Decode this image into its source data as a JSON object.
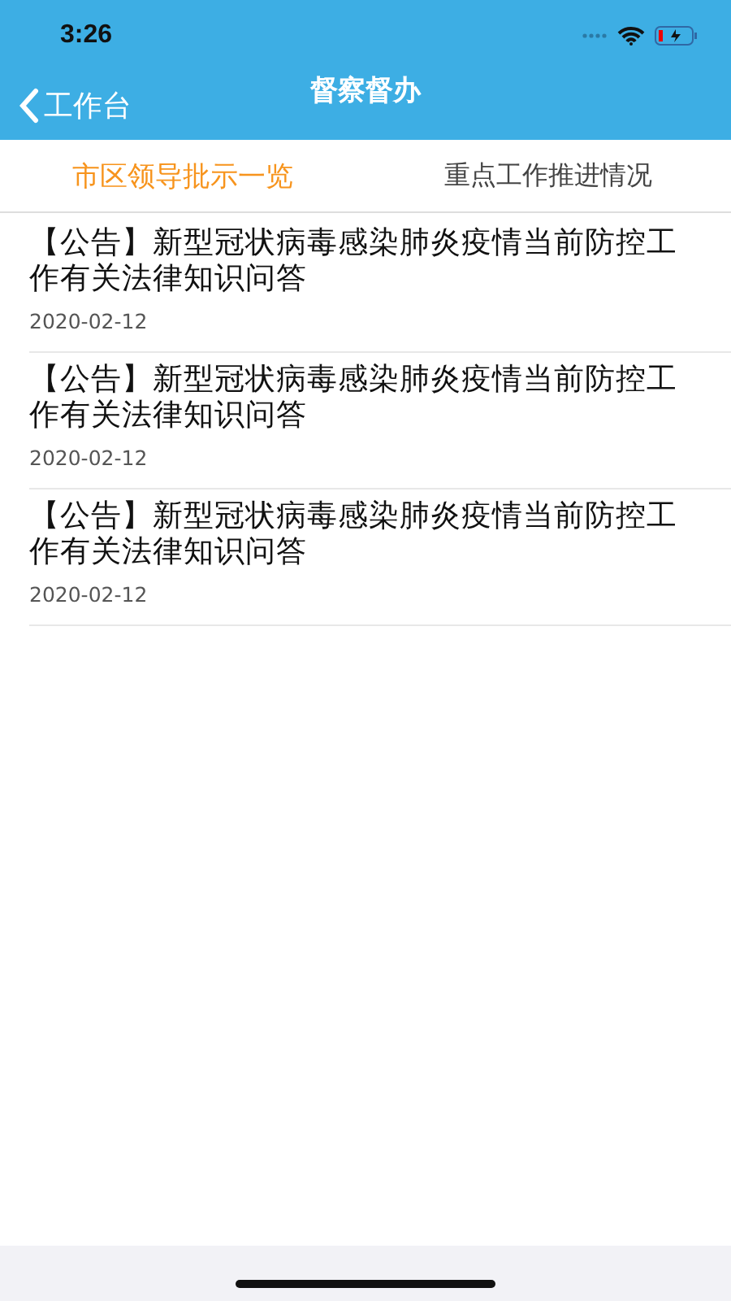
{
  "status_bar": {
    "time": "3:26"
  },
  "nav": {
    "back_label": "工作台",
    "title": "督察督办"
  },
  "tabs": [
    {
      "label": "市区领导批示一览",
      "selected": true
    },
    {
      "label": "重点工作推进情况",
      "selected": false
    }
  ],
  "notices": [
    {
      "title": "【公告】新型冠状病毒感染肺炎疫情当前防控工作有关法律知识问答",
      "date": "2020-02-12"
    },
    {
      "title": "【公告】新型冠状病毒感染肺炎疫情当前防控工作有关法律知识问答",
      "date": "2020-02-12"
    },
    {
      "title": "【公告】新型冠状病毒感染肺炎疫情当前防控工作有关法律知识问答",
      "date": "2020-02-12"
    }
  ]
}
